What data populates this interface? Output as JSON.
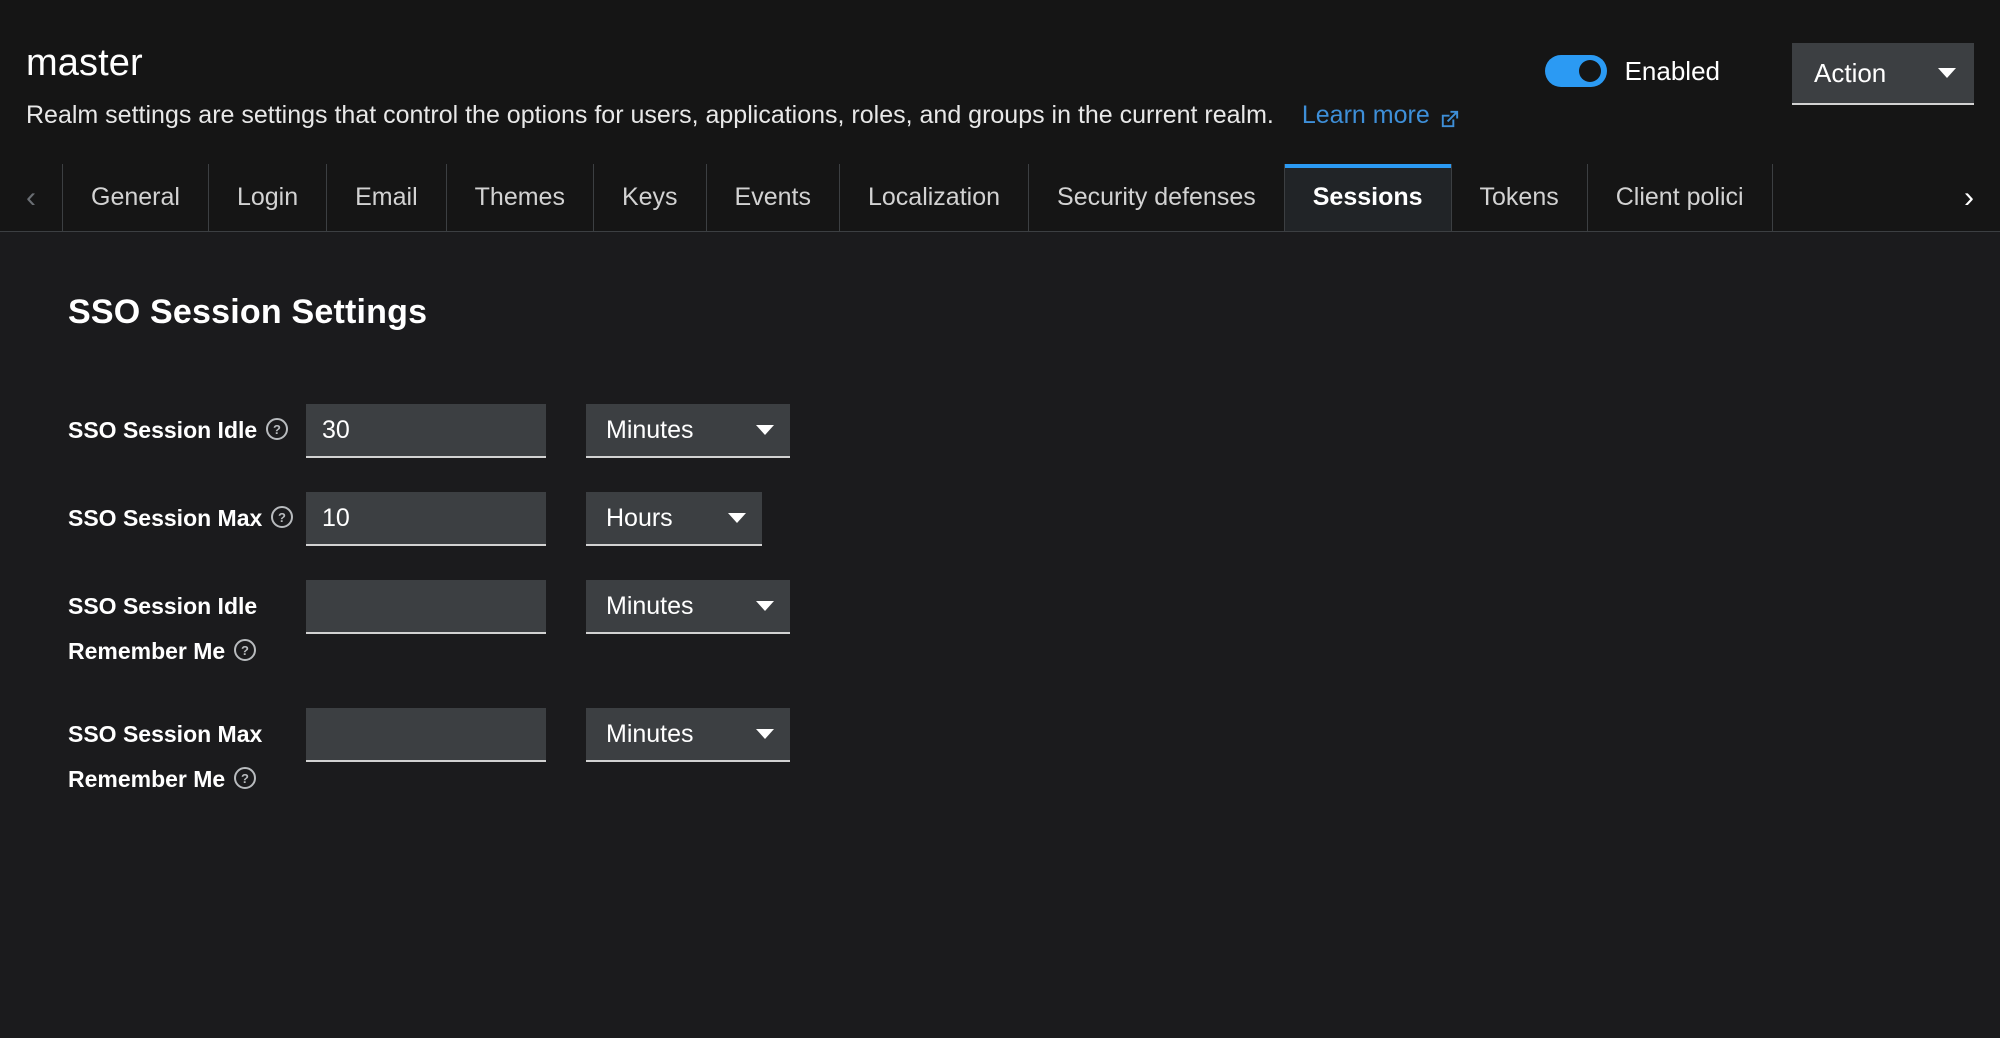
{
  "header": {
    "realm_name": "master",
    "description": "Realm settings are settings that control the options for users, applications, roles, and groups in the current realm.",
    "learn_more_label": "Learn more",
    "learn_more_icon": "external-link-icon",
    "enabled_toggle": {
      "label": "Enabled",
      "state": "on",
      "color": "#2b9af3"
    },
    "action_button": {
      "label": "Action",
      "caret_icon": "caret-down-icon"
    }
  },
  "tabs": {
    "scroll_left_icon": "chevron-left-icon",
    "scroll_right_icon": "chevron-right-icon",
    "items": [
      {
        "label": "General",
        "active": false
      },
      {
        "label": "Login",
        "active": false
      },
      {
        "label": "Email",
        "active": false
      },
      {
        "label": "Themes",
        "active": false
      },
      {
        "label": "Keys",
        "active": false
      },
      {
        "label": "Events",
        "active": false
      },
      {
        "label": "Localization",
        "active": false
      },
      {
        "label": "Security defenses",
        "active": false
      },
      {
        "label": "Sessions",
        "active": true
      },
      {
        "label": "Tokens",
        "active": false
      },
      {
        "label": "Client polici",
        "active": false
      }
    ],
    "active_indicator_color": "#2b9af3"
  },
  "main": {
    "section_title": "SSO Session Settings",
    "help_icon": "question-circle-icon",
    "dropdown_icon": "caret-down-icon",
    "fields": [
      {
        "label_line1": "SSO Session Idle",
        "label_line2": "",
        "value": "30",
        "placeholder": "",
        "unit": "Minutes",
        "unit_width": "w-minutes"
      },
      {
        "label_line1": "SSO Session Max",
        "label_line2": "",
        "value": "10",
        "placeholder": "",
        "unit": "Hours",
        "unit_width": "w-hours"
      },
      {
        "label_line1": "SSO Session Idle",
        "label_line2": "Remember Me",
        "value": "",
        "placeholder": "",
        "unit": "Minutes",
        "unit_width": "w-minutes"
      },
      {
        "label_line1": "SSO Session Max",
        "label_line2": "Remember Me",
        "value": "",
        "placeholder": "",
        "unit": "Minutes",
        "unit_width": "w-minutes"
      }
    ]
  }
}
